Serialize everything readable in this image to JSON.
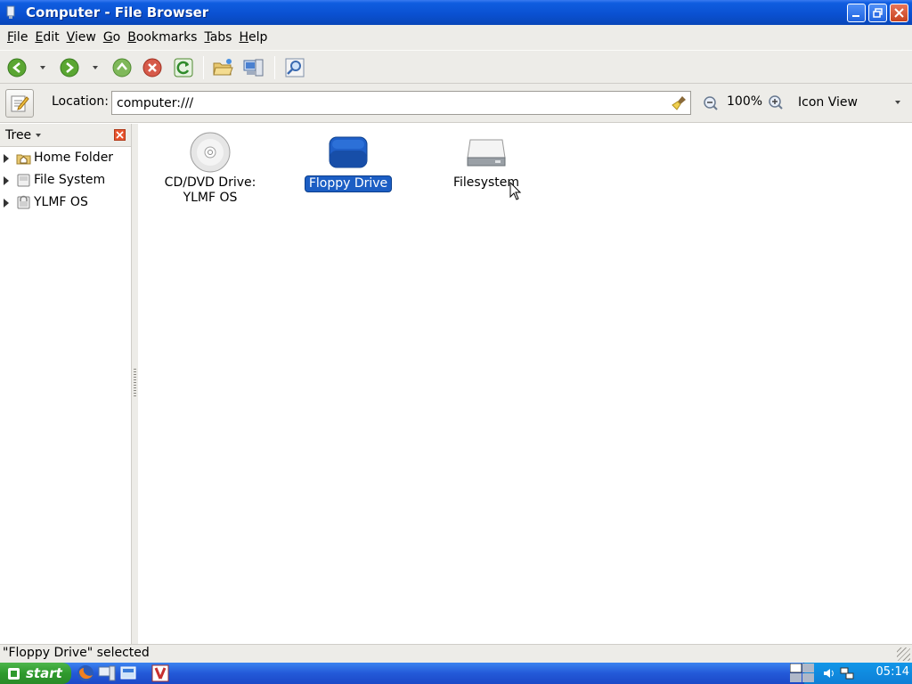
{
  "window": {
    "title": "Computer - File Browser"
  },
  "menubar": {
    "items": [
      {
        "label": "File",
        "mnemonic": "F",
        "rest": "ile"
      },
      {
        "label": "Edit",
        "mnemonic": "E",
        "rest": "dit"
      },
      {
        "label": "View",
        "mnemonic": "V",
        "rest": "iew"
      },
      {
        "label": "Go",
        "mnemonic": "G",
        "rest": "o"
      },
      {
        "label": "Bookmarks",
        "mnemonic": "B",
        "rest": "ookmarks"
      },
      {
        "label": "Tabs",
        "mnemonic": "T",
        "rest": "abs"
      },
      {
        "label": "Help",
        "mnemonic": "H",
        "rest": "elp"
      }
    ]
  },
  "toolbar": {
    "icons": [
      "back-icon",
      "forward-icon",
      "up-icon",
      "stop-icon",
      "reload-icon",
      "open-folder-icon",
      "computer-icon",
      "search-icon"
    ]
  },
  "location": {
    "label": "Location:",
    "value": "computer:///",
    "zoom": "100%",
    "view_mode": "Icon View"
  },
  "sidebar": {
    "mode": "Tree",
    "items": [
      {
        "label": "Home Folder",
        "icon": "home-folder-icon"
      },
      {
        "label": "File System",
        "icon": "drive-icon"
      },
      {
        "label": "YLMF OS",
        "icon": "drive-icon"
      }
    ]
  },
  "content": {
    "items": [
      {
        "label_line1": "CD/DVD Drive:",
        "label_line2": "YLMF OS",
        "icon": "cd-icon",
        "selected": false
      },
      {
        "label_line1": "Floppy Drive",
        "label_line2": "",
        "icon": "floppy-icon",
        "selected": true
      },
      {
        "label_line1": "Filesystem",
        "label_line2": "",
        "icon": "harddisk-icon",
        "selected": false
      }
    ]
  },
  "status": {
    "text": "\"Floppy Drive\" selected"
  },
  "taskbar": {
    "start_label": "start",
    "clock": "05:14"
  },
  "colors": {
    "selection": "#1c5ec4",
    "titlebar": "#0a50d0",
    "taskbar": "#2359d8",
    "start": "#2f9a2d"
  }
}
